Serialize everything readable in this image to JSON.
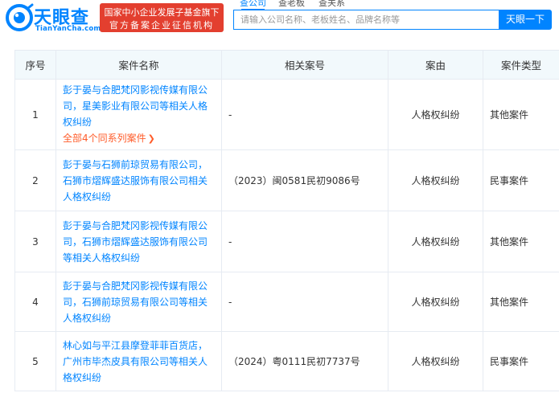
{
  "header": {
    "logo_text": "天眼查",
    "logo_en": "TianYanCha.com",
    "badge_line1": "国家中小企业发展子基金旗下",
    "badge_line2": "官方备案企业征信机构",
    "tabs": [
      {
        "label": "查公司"
      },
      {
        "label": "查老板"
      },
      {
        "label": "查关系"
      }
    ],
    "search_placeholder": "请输入公司名称、老板姓名、品牌名称等",
    "search_button": "天眼一下"
  },
  "table": {
    "headers": [
      "序号",
      "案件名称",
      "相关案号",
      "案由",
      "案件类型"
    ],
    "rows": [
      {
        "no": "1",
        "name": "彭于晏与合肥梵冈影视传媒有限公司，星美影业有限公司等相关人格权纠纷",
        "series_link": "全部4个同系列案件",
        "ref": "-",
        "cause": "人格权纠纷",
        "type": "其他案件"
      },
      {
        "no": "2",
        "name": "彭于晏与石狮前琼贸易有限公司，石狮市熠辉盛达服饰有限公司相关人格权纠纷",
        "ref": "（2023）闽0581民初9086号",
        "cause": "人格权纠纷",
        "type": "民事案件"
      },
      {
        "no": "3",
        "name": "彭于晏与合肥梵冈影视传媒有限公司，石狮市熠辉盛达服饰有限公司等相关人格权纠纷",
        "ref": "-",
        "cause": "人格权纠纷",
        "type": "其他案件"
      },
      {
        "no": "4",
        "name": "彭于晏与合肥梵冈影视传媒有限公司，石狮前琼贸易有限公司等相关人格权纠纷",
        "ref": "-",
        "cause": "人格权纠纷",
        "type": "其他案件"
      },
      {
        "no": "5",
        "name": "林心如与平江县摩登菲菲百货店，广州市毕杰皮具有限公司等相关人格权纠纷",
        "ref": "（2024）粤0111民初7737号",
        "cause": "人格权纠纷",
        "type": "民事案件"
      }
    ]
  },
  "colors": {
    "brand_blue": "#0084ff",
    "badge_red": "#e33f2f",
    "link_orange": "#ff5c2a",
    "header_bg": "#f2f9fc"
  }
}
